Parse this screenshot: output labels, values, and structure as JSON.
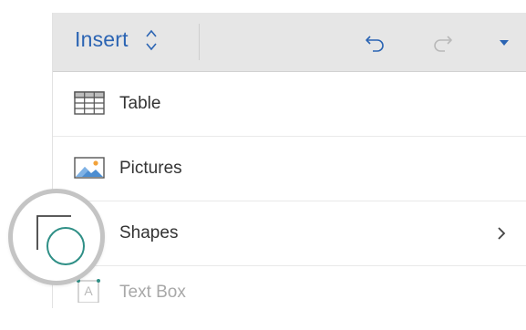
{
  "toolbar": {
    "tab_label": "Insert",
    "icons": {
      "switch": "up-down-icon",
      "undo": "undo-icon",
      "redo": "redo-icon",
      "more": "caret-down-icon"
    }
  },
  "menu": {
    "items": [
      {
        "label": "Table",
        "icon": "table-icon",
        "has_submenu": false
      },
      {
        "label": "Pictures",
        "icon": "pictures-icon",
        "has_submenu": false
      },
      {
        "label": "Shapes",
        "icon": "shapes-icon",
        "has_submenu": true
      },
      {
        "label": "Text Box",
        "icon": "text-box-icon",
        "has_submenu": false
      }
    ]
  },
  "colors": {
    "accent_blue": "#2b64b3",
    "toolbar_bg": "#e6e6e6",
    "shape_teal": "#2f8f86",
    "picture_blue": "#4d8ed1",
    "sun_orange": "#f2a23a",
    "magnifier_ring": "#c4c4c4"
  }
}
